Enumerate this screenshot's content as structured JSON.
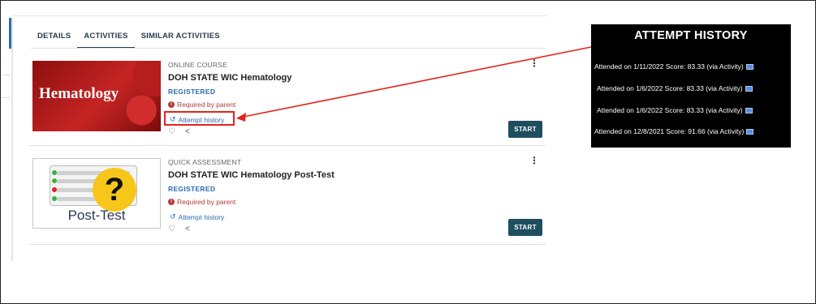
{
  "tabs": [
    {
      "label": "DETAILS"
    },
    {
      "label": "ACTIVITIES"
    },
    {
      "label": "SIMILAR ACTIVITIES"
    }
  ],
  "activities": [
    {
      "type": "ONLINE COURSE",
      "title": "DOH STATE WIC Hematology",
      "status": "REGISTERED",
      "required": "Required by parent",
      "attempt_link": "Attempt history",
      "thumb_text": "Hematology",
      "start_label": "START"
    },
    {
      "type": "QUICK ASSESSMENT",
      "title": "DOH STATE WIC Hematology Post-Test",
      "status": "REGISTERED",
      "required": "Required by parent",
      "attempt_link": "Attempt history",
      "thumb_text": "Post-Test",
      "start_label": "START"
    }
  ],
  "attempt_panel": {
    "title": "ATTEMPT HISTORY",
    "rows": [
      "Attended on 1/11/2022 Score: 83.33 (via Activity)",
      "Attended on 1/6/2022 Score: 83.33 (via Activity)",
      "Attended on 1/6/2022 Score: 83.33 (via Activity)",
      "Attended on 12/8/2021 Score: 91.66 (via Activity)"
    ]
  },
  "colors": {
    "accent": "#2b6cb0",
    "start_button": "#1f4e5f",
    "annotation": "#e3231c",
    "required": "#b23a3a"
  },
  "icons": {
    "attempt": "history-icon",
    "favorite": "heart-icon",
    "share": "share-icon",
    "menu": "kebab-menu-icon",
    "panel_row": "image-icon"
  }
}
